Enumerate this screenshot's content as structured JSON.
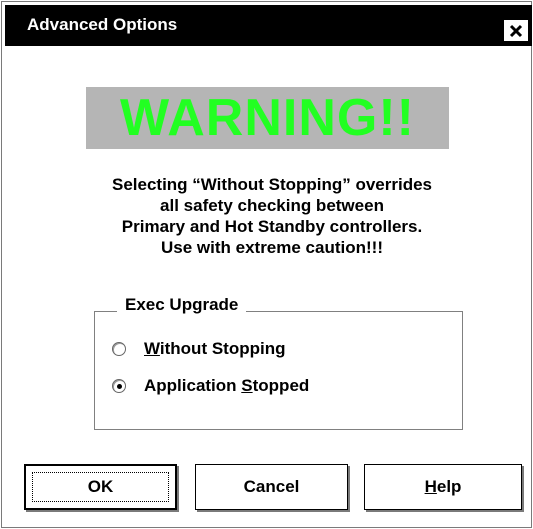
{
  "window": {
    "title": "Advanced Options",
    "close_icon": "close-x-icon"
  },
  "warning": {
    "text": "WARNING!!",
    "text_color": "#22ff22",
    "background": "#b5b5b5"
  },
  "message": {
    "lines": [
      "Selecting “Without Stopping” overrides",
      "all safety checking between",
      "Primary and Hot Standby controllers.",
      "Use with extreme caution!!!"
    ]
  },
  "group": {
    "title": "Exec Upgrade",
    "options": [
      {
        "mnemonic": "W",
        "rest": "ithout Stopping",
        "selected": false
      },
      {
        "prefix": "Application ",
        "mnemonic": "S",
        "rest": "topped",
        "selected": true
      }
    ]
  },
  "buttons": {
    "ok": "OK",
    "cancel": "Cancel",
    "help_mnemonic": "H",
    "help_rest": "elp"
  }
}
